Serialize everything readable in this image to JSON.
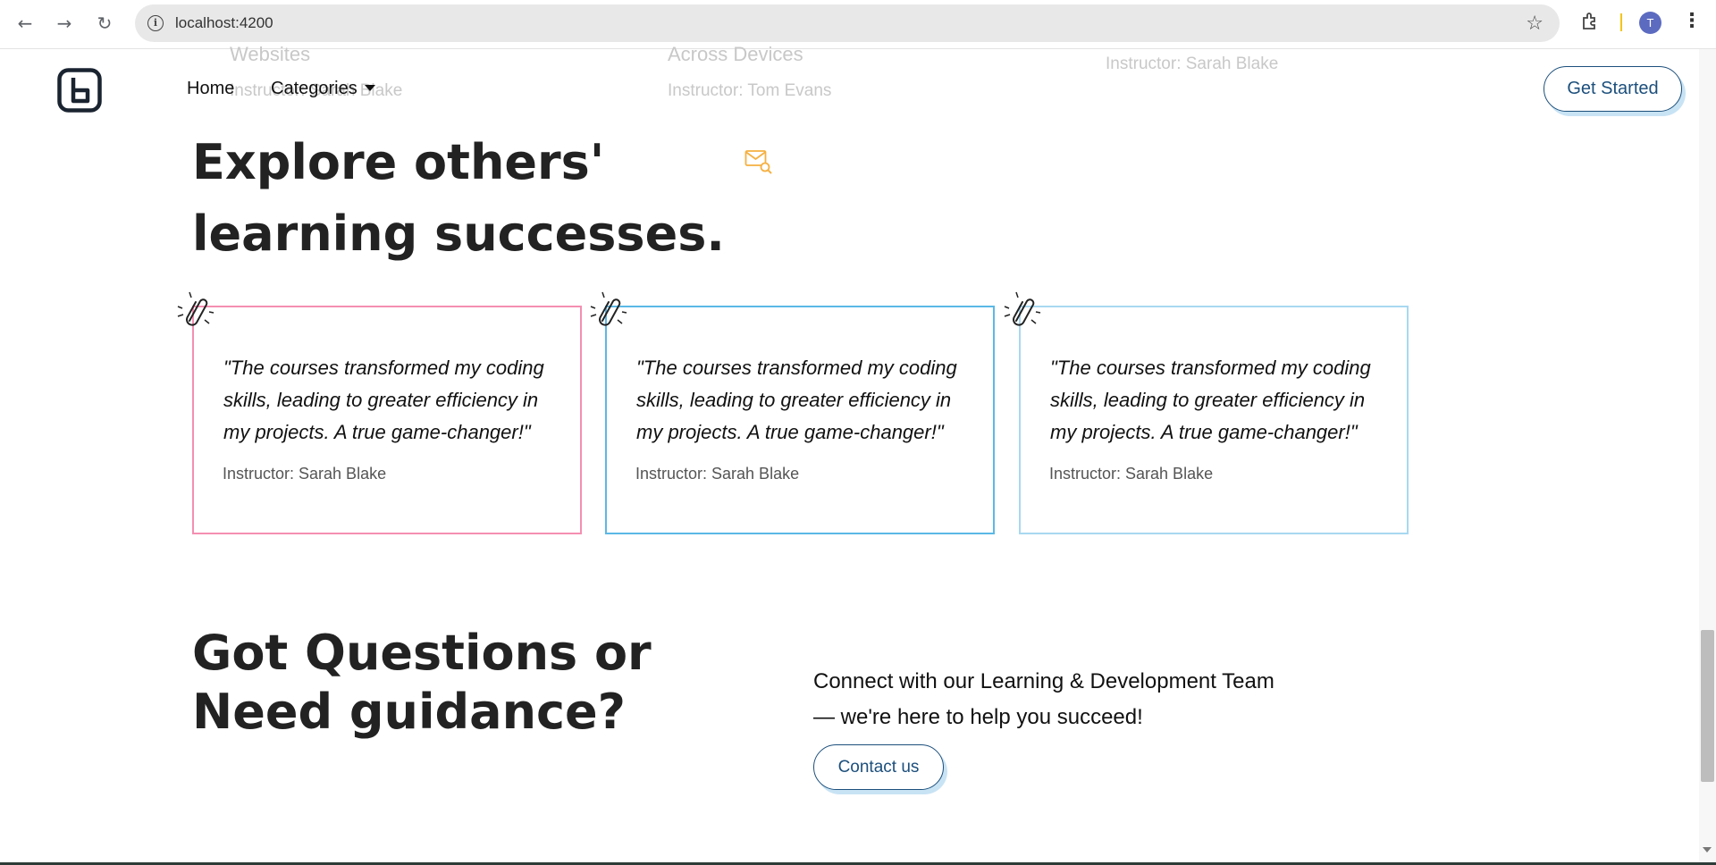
{
  "browser": {
    "url": "localhost:4200",
    "avatar_initial": "T",
    "back_icon": "arrow-left-icon",
    "forward_icon": "arrow-right-icon",
    "reload_icon": "reload-icon"
  },
  "behind_header": {
    "col1_title": "Websites",
    "col1_instructor": "Instructor: Sarah Blake",
    "col2_title": "Across Devices",
    "col2_instructor": "Instructor: Tom Evans",
    "col3_instructor": "Instructor: Sarah Blake"
  },
  "nav": {
    "home": "Home",
    "categories": "Categories",
    "get_started": "Get Started"
  },
  "explore": {
    "heading": "Explore others' learning successes."
  },
  "testimonials": [
    {
      "quote": "\"The courses transformed my coding skills, leading to greater efficiency in my projects. A true game-changer!\"",
      "author": "Instructor: Sarah Blake",
      "border": "#f48fb1"
    },
    {
      "quote": "\"The courses transformed my coding skills, leading to greater efficiency in my projects. A true game-changer!\"",
      "author": "Instructor: Sarah Blake",
      "border": "#5bb8e6"
    },
    {
      "quote": "\"The courses transformed my coding skills, leading to greater efficiency in my projects. A true game-changer!\"",
      "author": "Instructor: Sarah Blake",
      "border": "#a8d8f0"
    }
  ],
  "questions": {
    "heading": "Got Questions or Need guidance?",
    "text": "Connect with our Learning & Development Team — we're here to help you succeed!",
    "button": "Contact us"
  },
  "colors": {
    "accent": "#1c4f7c",
    "button_shadow": "#c8e3f4",
    "mail_icon": "#f5b041"
  }
}
